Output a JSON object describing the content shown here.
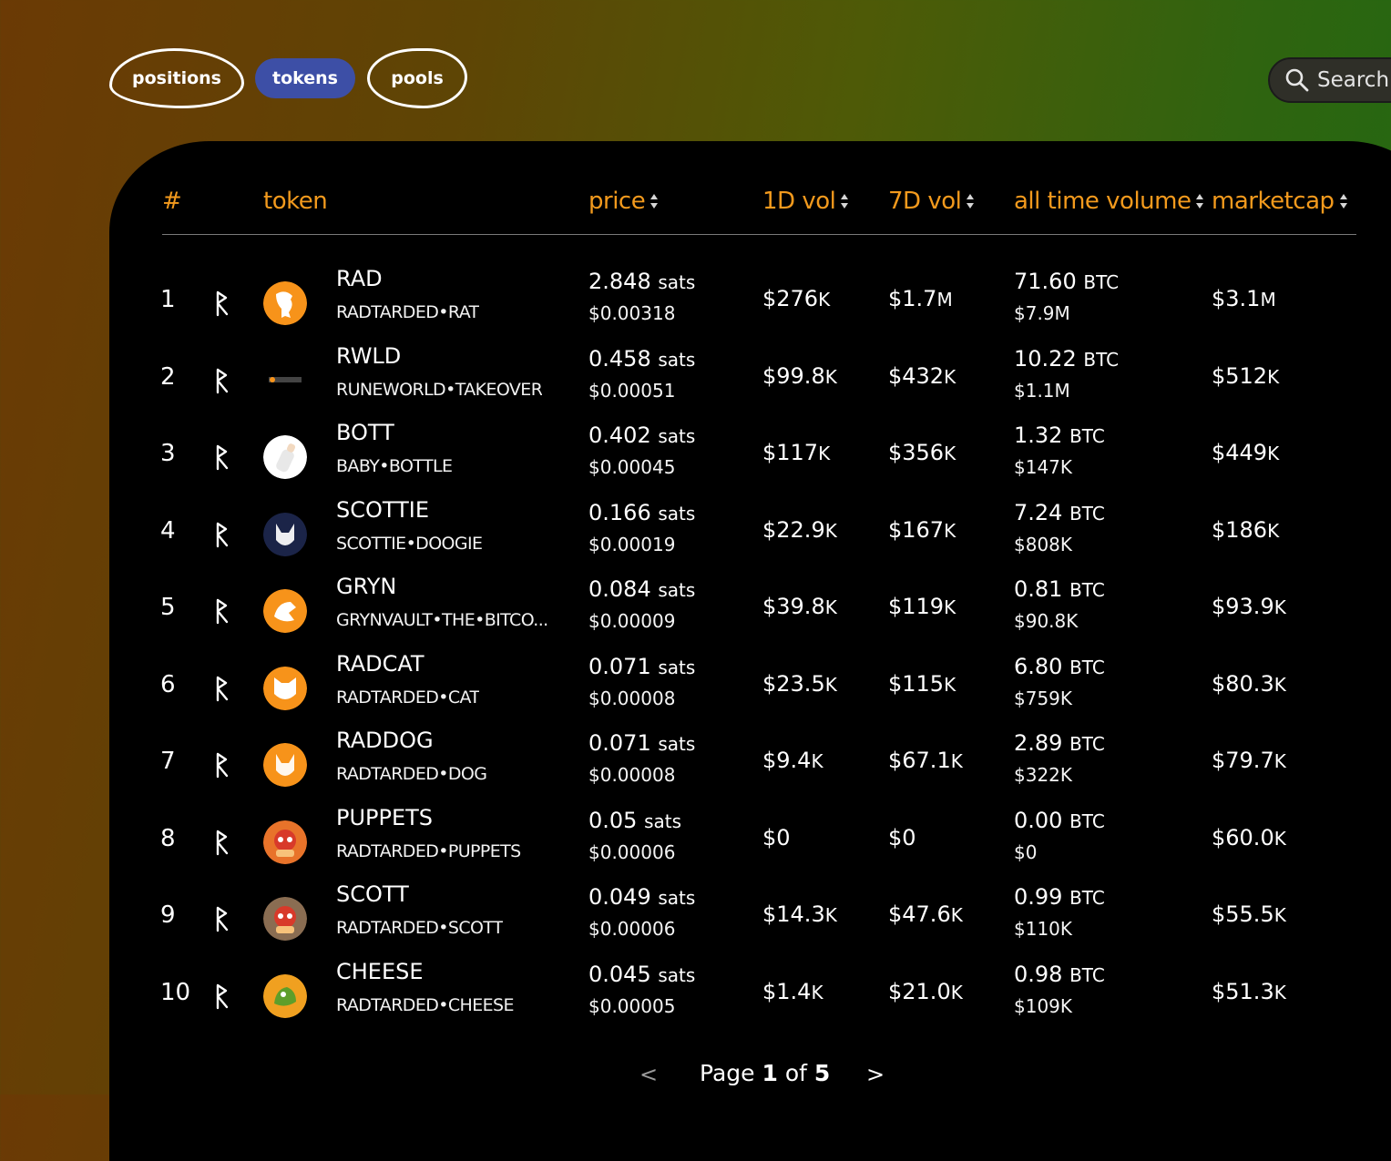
{
  "tabs": {
    "positions": "positions",
    "tokens": "tokens",
    "pools": "pools"
  },
  "search": {
    "placeholder": "Search"
  },
  "table": {
    "headers": {
      "rank": "#",
      "token": "token",
      "price": "price",
      "vol1d": "1D vol",
      "vol7d": "7D vol",
      "alltime": "all time volume",
      "marketcap": "marketcap"
    },
    "rows": [
      {
        "rank": "1",
        "name": "RAD",
        "sub": "RADTARDED•RAT",
        "price_sats": "2.848",
        "price_unit": "sats",
        "price_usd": "$0.00318",
        "vol1d": "$276",
        "vol1d_sfx": "K",
        "vol7d": "$1.7",
        "vol7d_sfx": "M",
        "at_btc": "71.60",
        "at_unit": "BTC",
        "at_usd": "$7.9M",
        "mc": "$3.1",
        "mc_sfx": "M",
        "avatar_color": "#f7931a",
        "avatar_icon": "rat-icon"
      },
      {
        "rank": "2",
        "name": "RWLD",
        "sub": "RUNEWORLD•TAKEOVER",
        "price_sats": "0.458",
        "price_unit": "sats",
        "price_usd": "$0.00051",
        "vol1d": "$99.8",
        "vol1d_sfx": "K",
        "vol7d": "$432",
        "vol7d_sfx": "K",
        "at_btc": "10.22",
        "at_unit": "BTC",
        "at_usd": "$1.1M",
        "mc": "$512",
        "mc_sfx": "K",
        "avatar_color": "#000000",
        "avatar_icon": "runeworld-icon"
      },
      {
        "rank": "3",
        "name": "BOTT",
        "sub": "BABY•BOTTLE",
        "price_sats": "0.402",
        "price_unit": "sats",
        "price_usd": "$0.00045",
        "vol1d": "$117",
        "vol1d_sfx": "K",
        "vol7d": "$356",
        "vol7d_sfx": "K",
        "at_btc": "1.32",
        "at_unit": "BTC",
        "at_usd": "$147K",
        "mc": "$449",
        "mc_sfx": "K",
        "avatar_color": "#ffffff",
        "avatar_icon": "bottle-icon"
      },
      {
        "rank": "4",
        "name": "SCOTTIE",
        "sub": "SCOTTIE•DOOGIE",
        "price_sats": "0.166",
        "price_unit": "sats",
        "price_usd": "$0.00019",
        "vol1d": "$22.9",
        "vol1d_sfx": "K",
        "vol7d": "$167",
        "vol7d_sfx": "K",
        "at_btc": "7.24",
        "at_unit": "BTC",
        "at_usd": "$808K",
        "mc": "$186",
        "mc_sfx": "K",
        "avatar_color": "#1b2448",
        "avatar_icon": "dog-icon"
      },
      {
        "rank": "5",
        "name": "GRYN",
        "sub": "GRYNVAULT•THE•BITCO...",
        "price_sats": "0.084",
        "price_unit": "sats",
        "price_usd": "$0.00009",
        "vol1d": "$39.8",
        "vol1d_sfx": "K",
        "vol7d": "$119",
        "vol7d_sfx": "K",
        "at_btc": "0.81",
        "at_unit": "BTC",
        "at_usd": "$90.8K",
        "mc": "$93.9",
        "mc_sfx": "K",
        "avatar_color": "#f7931a",
        "avatar_icon": "gryn-icon"
      },
      {
        "rank": "6",
        "name": "RADCAT",
        "sub": "RADTARDED•CAT",
        "price_sats": "0.071",
        "price_unit": "sats",
        "price_usd": "$0.00008",
        "vol1d": "$23.5",
        "vol1d_sfx": "K",
        "vol7d": "$115",
        "vol7d_sfx": "K",
        "at_btc": "6.80",
        "at_unit": "BTC",
        "at_usd": "$759K",
        "mc": "$80.3",
        "mc_sfx": "K",
        "avatar_color": "#f7931a",
        "avatar_icon": "cat-icon"
      },
      {
        "rank": "7",
        "name": "RADDOG",
        "sub": "RADTARDED•DOG",
        "price_sats": "0.071",
        "price_unit": "sats",
        "price_usd": "$0.00008",
        "vol1d": "$9.4",
        "vol1d_sfx": "K",
        "vol7d": "$67.1",
        "vol7d_sfx": "K",
        "at_btc": "2.89",
        "at_unit": "BTC",
        "at_usd": "$322K",
        "mc": "$79.7",
        "mc_sfx": "K",
        "avatar_color": "#f7931a",
        "avatar_icon": "dog-icon"
      },
      {
        "rank": "8",
        "name": "PUPPETS",
        "sub": "RADTARDED•PUPPETS",
        "price_sats": "0.05",
        "price_unit": "sats",
        "price_usd": "$0.00006",
        "vol1d": "$0",
        "vol1d_sfx": "",
        "vol7d": "$0",
        "vol7d_sfx": "",
        "at_btc": "0.00",
        "at_unit": "BTC",
        "at_usd": "$0",
        "mc": "$60.0",
        "mc_sfx": "K",
        "avatar_color": "#e8732a",
        "avatar_icon": "puppet-icon"
      },
      {
        "rank": "9",
        "name": "SCOTT",
        "sub": "RADTARDED•SCOTT",
        "price_sats": "0.049",
        "price_unit": "sats",
        "price_usd": "$0.00006",
        "vol1d": "$14.3",
        "vol1d_sfx": "K",
        "vol7d": "$47.6",
        "vol7d_sfx": "K",
        "at_btc": "0.99",
        "at_unit": "BTC",
        "at_usd": "$110K",
        "mc": "$55.5",
        "mc_sfx": "K",
        "avatar_color": "#8a6d52",
        "avatar_icon": "puppet-icon"
      },
      {
        "rank": "10",
        "name": "CHEESE",
        "sub": "RADTARDED•CHEESE",
        "price_sats": "0.045",
        "price_unit": "sats",
        "price_usd": "$0.00005",
        "vol1d": "$1.4",
        "vol1d_sfx": "K",
        "vol7d": "$21.0",
        "vol7d_sfx": "K",
        "at_btc": "0.98",
        "at_unit": "BTC",
        "at_usd": "$109K",
        "mc": "$51.3",
        "mc_sfx": "K",
        "avatar_color": "#f0a020",
        "avatar_icon": "cheese-icon"
      }
    ]
  },
  "pagination": {
    "prev": "<",
    "page_word": "Page",
    "current": "1",
    "of_word": "of",
    "total": "5",
    "next": ">"
  }
}
